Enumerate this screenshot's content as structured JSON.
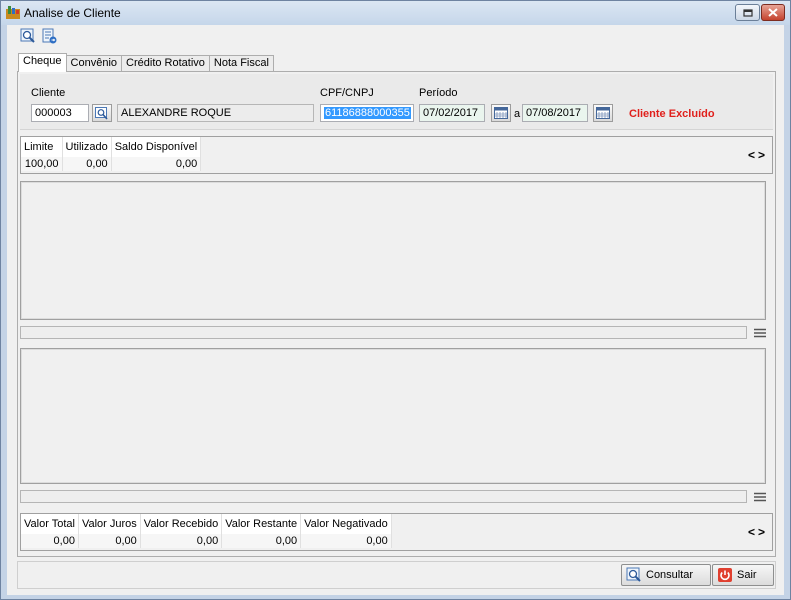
{
  "window": {
    "title": "Analise de Cliente"
  },
  "toolbar": {
    "search_icon": "search-report-icon",
    "export_icon": "export-icon"
  },
  "tabs": [
    {
      "label": "Cheque"
    },
    {
      "label": "Convênio"
    },
    {
      "label": "Crédito Rotativo"
    },
    {
      "label": "Nota Fiscal"
    }
  ],
  "filter": {
    "cliente_label": "Cliente",
    "cliente_code": "000003",
    "cliente_name": "ALEXANDRE ROQUE",
    "cpf_label": "CPF/CNPJ",
    "cpf_value": "61186888000355",
    "periodo_label": "Período",
    "date_from": "07/02/2017",
    "date_sep": "a",
    "date_to": "07/08/2017",
    "status": "Cliente Excluído",
    "status_color": "#e0201c"
  },
  "limits": {
    "headers": [
      "Limite",
      "Utilizado",
      "Saldo Disponível"
    ],
    "values": [
      "100,00",
      "0,00",
      "0,00"
    ]
  },
  "totals": {
    "headers": [
      "Valor Total",
      "Valor Juros",
      "Valor Recebido",
      "Valor Restante",
      "Valor Negativado"
    ],
    "values": [
      "0,00",
      "0,00",
      "0,00",
      "0,00",
      "0,00"
    ]
  },
  "nav": {
    "prev": "<",
    "next": ">"
  },
  "buttons": {
    "consultar": "Consultar",
    "sair": "Sair"
  }
}
